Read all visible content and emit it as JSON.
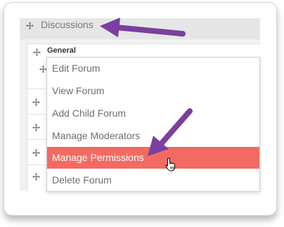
{
  "category": {
    "title": "Discussions"
  },
  "subcategory": {
    "title": "General"
  },
  "menu": {
    "items": [
      {
        "label": "Edit Forum"
      },
      {
        "label": "View Forum"
      },
      {
        "label": "Add Child Forum"
      },
      {
        "label": "Manage Moderators"
      },
      {
        "label": "Manage Permissions",
        "active": true
      },
      {
        "label": "Delete Forum"
      }
    ]
  },
  "colors": {
    "highlight": "#f26b63",
    "annotation_arrow": "#7a3fa0"
  },
  "icons": [
    "move-icon",
    "hand-cursor-icon",
    "annotation-arrow"
  ]
}
